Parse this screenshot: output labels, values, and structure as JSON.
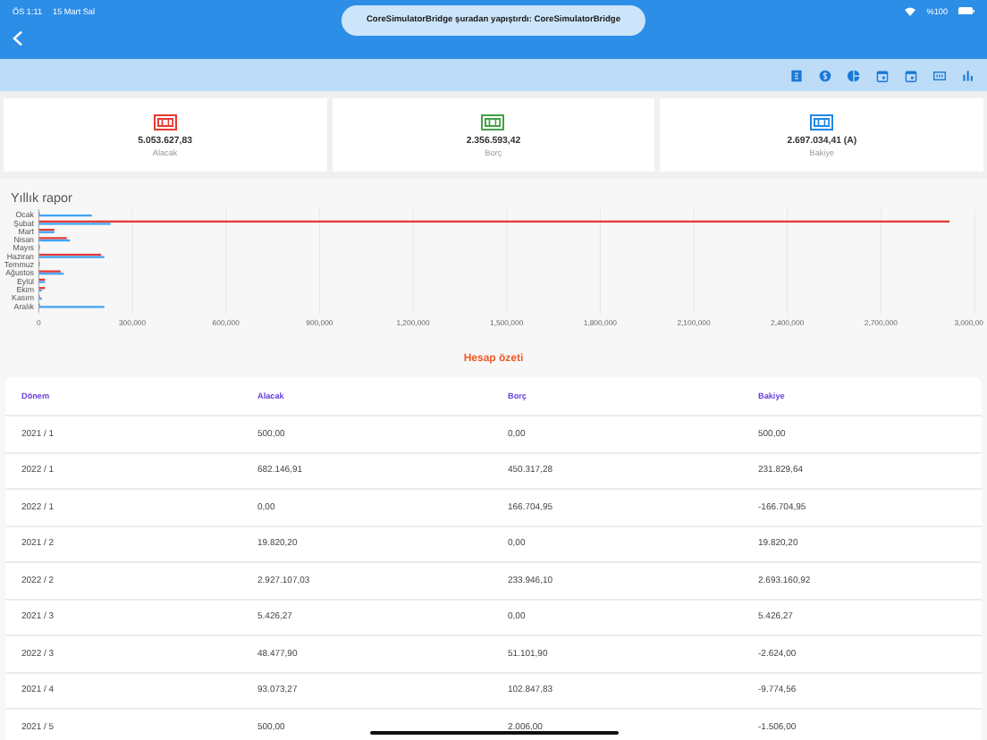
{
  "status_bar": {
    "time": "ÖS 1:11",
    "date": "15 Mart Sal",
    "battery": "%100"
  },
  "toast": {
    "text": "CoreSimulatorBridge şuradan yapıştırdı: CoreSimulatorBridge"
  },
  "summary_cards": [
    {
      "value": "5.053.627,83",
      "label": "Alacak",
      "color": "#e53935"
    },
    {
      "value": "2.356.593,42",
      "label": "Borç",
      "color": "#43a047"
    },
    {
      "value": "2.697.034,41 (A)",
      "label": "Bakiye",
      "color": "#1e88e5"
    }
  ],
  "chart": {
    "chart_data": {
      "type": "bar",
      "title": "Yıllık rapor",
      "orientation": "horizontal",
      "categories": [
        "Ocak",
        "Şubat",
        "Mart",
        "Nisan",
        "Mayıs",
        "Haziran",
        "Temmuz",
        "Ağustos",
        "Eylül",
        "Ekim",
        "Kasım",
        "Aralık"
      ],
      "series": [
        {
          "color": "#e53935",
          "values": [
            0,
            2920000,
            50000,
            90000,
            0,
            200000,
            0,
            70000,
            20000,
            20000,
            0,
            0
          ]
        },
        {
          "color": "#42a5f5",
          "values": [
            170000,
            230000,
            50000,
            100000,
            0,
            210000,
            0,
            80000,
            20000,
            10000,
            10000,
            210000
          ]
        }
      ],
      "grid": true,
      "xlim": [
        0,
        3000000
      ],
      "xticks": [
        {
          "value": 0,
          "label": "0"
        },
        {
          "value": 300000,
          "label": "300,000"
        },
        {
          "value": 600000,
          "label": "600,000"
        },
        {
          "value": 900000,
          "label": "900,000"
        },
        {
          "value": 1200000,
          "label": "1,200,000"
        },
        {
          "value": 1500000,
          "label": "1,500,000"
        },
        {
          "value": 1800000,
          "label": "1,800,000"
        },
        {
          "value": 2100000,
          "label": "2,100,000"
        },
        {
          "value": 2400000,
          "label": "2,400,000"
        },
        {
          "value": 2700000,
          "label": "2,700,000"
        },
        {
          "value": 3000000,
          "label": "3,000,00"
        }
      ]
    }
  },
  "section_title": "Hesap özeti",
  "table": {
    "columns": [
      "Dönem",
      "Alacak",
      "Borç",
      "Bakiye"
    ],
    "rows": [
      [
        "2021 / 1",
        "500,00",
        "0,00",
        "500,00"
      ],
      [
        "2022 / 1",
        "682.146,91",
        "450.317,28",
        "231.829,64"
      ],
      [
        "2022 / 1",
        "0,00",
        "166.704,95",
        "-166.704,95"
      ],
      [
        "2021 / 2",
        "19.820,20",
        "0,00",
        "19.820,20"
      ],
      [
        "2022 / 2",
        "2.927.107,03",
        "233.946,10",
        "2.693.160,92"
      ],
      [
        "2021 / 3",
        "5.426,27",
        "0,00",
        "5.426,27"
      ],
      [
        "2022 / 3",
        "48.477,90",
        "51.101,90",
        "-2.624,00"
      ],
      [
        "2021 / 4",
        "93.073,27",
        "102.847,83",
        "-9.774,56"
      ],
      [
        "2021 / 5",
        "500,00",
        "2.006,00",
        "-1.506,00"
      ]
    ]
  }
}
